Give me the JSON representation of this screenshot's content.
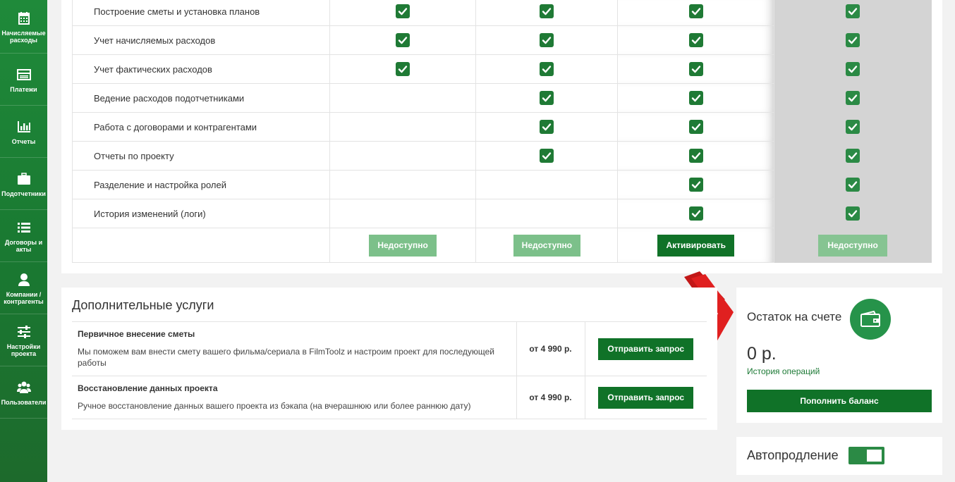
{
  "sidebar": {
    "items": [
      {
        "label": "Начисляемые расходы",
        "icon": "calendar-icon"
      },
      {
        "label": "Платежи",
        "icon": "card-icon"
      },
      {
        "label": "Отчеты",
        "icon": "bar-chart-icon"
      },
      {
        "label": "Подотчетники",
        "icon": "briefcase-icon"
      },
      {
        "label": "Договоры и акты",
        "icon": "list-icon"
      },
      {
        "label": "Компании / контрагенты",
        "icon": "user-icon"
      },
      {
        "label": "Настройки проекта",
        "icon": "sliders-icon"
      },
      {
        "label": "Пользователи",
        "icon": "users-icon"
      }
    ]
  },
  "plans": {
    "features": [
      {
        "name": "Построение сметы и установка планов",
        "checks": [
          true,
          true,
          true,
          true
        ]
      },
      {
        "name": "Учет начисляемых расходов",
        "checks": [
          true,
          true,
          true,
          true
        ]
      },
      {
        "name": "Учет фактических расходов",
        "checks": [
          true,
          true,
          true,
          true
        ]
      },
      {
        "name": "Ведение расходов подотчетниками",
        "checks": [
          false,
          true,
          true,
          true
        ]
      },
      {
        "name": "Работа с договорами и контрагентами",
        "checks": [
          false,
          true,
          true,
          true
        ]
      },
      {
        "name": "Отчеты по проекту",
        "checks": [
          false,
          true,
          true,
          true
        ]
      },
      {
        "name": "Разделение и настройка ролей",
        "checks": [
          false,
          false,
          true,
          true
        ]
      },
      {
        "name": "История изменений (логи)",
        "checks": [
          false,
          false,
          true,
          true
        ]
      }
    ],
    "buttons": [
      "Недоступно",
      "Недоступно",
      "Активировать",
      "Недоступно"
    ]
  },
  "services": {
    "title": "Дополнительные услуги",
    "items": [
      {
        "name": "Первичное внесение сметы",
        "description": "Мы поможем вам внести смету вашего фильма/сериала в FilmToolz и настроим проект для последующей работы",
        "price": "от 4 990 р.",
        "button": "Отправить запрос"
      },
      {
        "name": "Восстановление данных проекта",
        "description": "Ручное восстановление данных вашего проекта из бэкапа (на вчерашнюю или более раннюю дату)",
        "price": "от 4 990 р.",
        "button": "Отправить запрос"
      }
    ]
  },
  "balance": {
    "title": "Остаток на счете",
    "amount": "0 р.",
    "history_link": "История операций",
    "topup_button": "Пополнить баланс",
    "icon": "wallet-icon"
  },
  "autorenew": {
    "label": "Автопродление",
    "enabled": true
  },
  "colors": {
    "brand_green": "#107228",
    "check_green": "#1f7a35",
    "disabled_green": "#7cc08a",
    "annotation_red": "#e02020"
  }
}
